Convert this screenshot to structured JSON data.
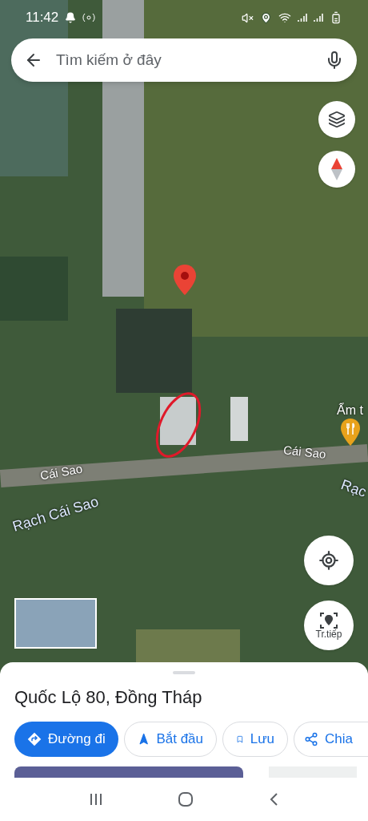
{
  "status_bar": {
    "time": "11:42"
  },
  "search": {
    "placeholder": "Tìm kiếm ở đây"
  },
  "map_labels": [
    {
      "text": "Cái Sao",
      "kind": "road"
    },
    {
      "text": "Cái Sao",
      "kind": "road"
    },
    {
      "text": "Rạch Cái Sao",
      "kind": "river"
    },
    {
      "text": "Rạc",
      "kind": "river"
    },
    {
      "text": "Ẩm t",
      "kind": "place"
    }
  ],
  "map_controls": {
    "live_view_label": "Tr.tiếp"
  },
  "place": {
    "title": "Quốc Lộ 80, Đồng Tháp"
  },
  "actions": [
    {
      "label": "Đường đi",
      "kind": "directions"
    },
    {
      "label": "Bắt đầu",
      "kind": "start"
    },
    {
      "label": "Lưu",
      "kind": "save"
    },
    {
      "label": "Chia",
      "kind": "share"
    }
  ]
}
